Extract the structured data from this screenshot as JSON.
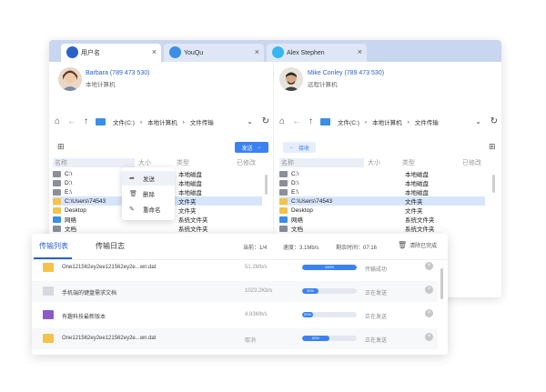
{
  "tabs": [
    {
      "label": "用户名",
      "close": "×"
    },
    {
      "label": "YouQu",
      "close": "×"
    },
    {
      "label": "Alex Stephen",
      "close": "×"
    }
  ],
  "left": {
    "user_name": "Barbara (789 473 530)",
    "user_sub": "本地计算机",
    "path": [
      "文件(C:)",
      "本地计算机",
      "文件传输"
    ],
    "send_label": "发送",
    "columns": [
      "名称",
      "大小",
      "类型",
      "已修改"
    ],
    "files": [
      {
        "name": "C:\\",
        "type": "本地磁盘",
        "color": "#8a8f99"
      },
      {
        "name": "D:\\",
        "type": "本地磁盘",
        "color": "#8a8f99"
      },
      {
        "name": "E:\\",
        "type": "本地磁盘",
        "color": "#8a8f99"
      },
      {
        "name": "C:\\Users\\74543",
        "type": "文件夹",
        "color": "#f5c24a"
      },
      {
        "name": "Desktop",
        "type": "文件夹",
        "color": "#f5c24a"
      },
      {
        "name": "网络",
        "type": "系统文件夹",
        "color": "#3a8ee6"
      },
      {
        "name": "文档",
        "type": "系统文件夹",
        "color": "#8a8f99"
      }
    ]
  },
  "right": {
    "user_name": "Mike Conley (789 473 530)",
    "user_sub": "远程计算机",
    "path": [
      "文件(C:)",
      "本地计算机",
      "文件传输"
    ],
    "recv_label": "接收",
    "columns": [
      "名称",
      "大小",
      "类型",
      "已修改"
    ],
    "files": [
      {
        "name": "C:\\",
        "type": "本地磁盘",
        "color": "#8a8f99"
      },
      {
        "name": "D:\\",
        "type": "本地磁盘",
        "color": "#8a8f99"
      },
      {
        "name": "E:\\",
        "type": "本地磁盘",
        "color": "#8a8f99"
      },
      {
        "name": "C:\\Users\\74543",
        "type": "文件夹",
        "color": "#f5c24a"
      },
      {
        "name": "Desktop",
        "type": "文件夹",
        "color": "#f5c24a"
      },
      {
        "name": "网络",
        "type": "系统文件夹",
        "color": "#3a8ee6"
      },
      {
        "name": "文档",
        "type": "系统文件夹",
        "color": "#8a8f99"
      }
    ]
  },
  "context_menu": {
    "items": [
      {
        "label": "发送",
        "icon": "send-icon"
      },
      {
        "label": "删除",
        "icon": "trash-icon"
      },
      {
        "label": "重命名",
        "icon": "pencil-icon"
      }
    ]
  },
  "transfer": {
    "tab_list": "传输列表",
    "tab_log": "传输日志",
    "current": "当前：1/4",
    "speed": "速度：3.1Mb/s",
    "remaining": "剩余时间：07:16",
    "clear_label": "清除已完成",
    "rows": [
      {
        "name": "One121562ey2ee121562ey2e...wn.dat",
        "speed": "51.2Mb/s",
        "progress": 100,
        "progress_label": "100%",
        "status": "传输成功",
        "icon_color": "#f5c24a"
      },
      {
        "name": "手机端的键盘需求文档",
        "speed": "1023.2Kb/s",
        "progress": 30,
        "progress_label": "30%",
        "status": "正在发送",
        "icon_color": "#d5d9e0"
      },
      {
        "name": "有趣科技最新版本",
        "speed": "4.83Mb/s",
        "progress": 20,
        "progress_label": "20%",
        "status": "正在发送",
        "icon_color": "#8b5cc6"
      },
      {
        "name": "One121562ey2ee121562ey2e...wn.dat",
        "speed": "取消",
        "progress": 50,
        "progress_label": "50%",
        "status": "正在发送",
        "icon_color": "#f5c24a"
      }
    ]
  },
  "colors": {
    "accent": "#3b82f0",
    "tabbar": "#c9d6ef",
    "selection": "#d7e5fb"
  }
}
